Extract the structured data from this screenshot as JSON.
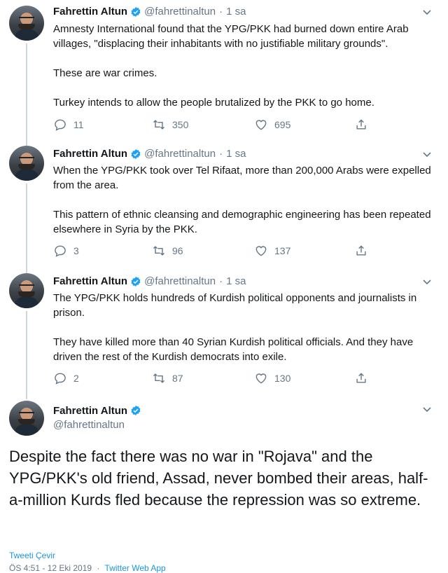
{
  "tweets": [
    {
      "name": "Fahrettin Altun",
      "handle": "@fahrettinaltun",
      "separator": "·",
      "time": "1 sa",
      "text": "Amnesty International found that the YPG/PKK had burned down entire Arab villages, \"displacing their inhabitants with no justifiable military grounds\".\n\nThese are war crimes.\n\nTurkey intends to allow the people brutalized by the PKK to go home.",
      "replies": "11",
      "retweets": "350",
      "likes": "695"
    },
    {
      "name": "Fahrettin Altun",
      "handle": "@fahrettinaltun",
      "separator": "·",
      "time": "1 sa",
      "text": "When the YPG/PKK took over Tel Rifaat, more than 200,000 Arabs were expelled from the area.\n\nThis pattern of ethnic cleansing and demographic engineering has been repeated elsewhere in Syria by the PKK.",
      "replies": "3",
      "retweets": "96",
      "likes": "137"
    },
    {
      "name": "Fahrettin Altun",
      "handle": "@fahrettinaltun",
      "separator": "·",
      "time": "1 sa",
      "text": "The YPG/PKK holds hundreds of Kurdish political opponents and journalists in prison.\n\nThey have killed more than 40 Syrian Kurdish political officials. And they have driven the rest of the Kurdish democrats into exile.",
      "replies": "2",
      "retweets": "87",
      "likes": "130"
    }
  ],
  "main_tweet": {
    "name": "Fahrettin Altun",
    "handle": "@fahrettinaltun",
    "text": "Despite the fact there was no war in \"Rojava\" and the YPG/PKK's old friend, Assad, never bombed their areas, half-a-million Kurds fled because the repression was so extreme.",
    "translate_label": "Tweeti Çevir",
    "timestamp": "ÖS 4:51 - 12 Eki 2019",
    "meta_separator": "·",
    "source": "Twitter Web App"
  },
  "colors": {
    "text": "#14171a",
    "secondary": "#657786",
    "link": "#1b95e0",
    "verified": "#1da1f2",
    "thread_line": "#ccd6dd"
  },
  "icons": {
    "verified": "verified-badge-icon",
    "chevron": "chevron-down-icon",
    "reply": "reply-icon",
    "retweet": "retweet-icon",
    "like": "heart-icon",
    "share": "share-icon"
  }
}
